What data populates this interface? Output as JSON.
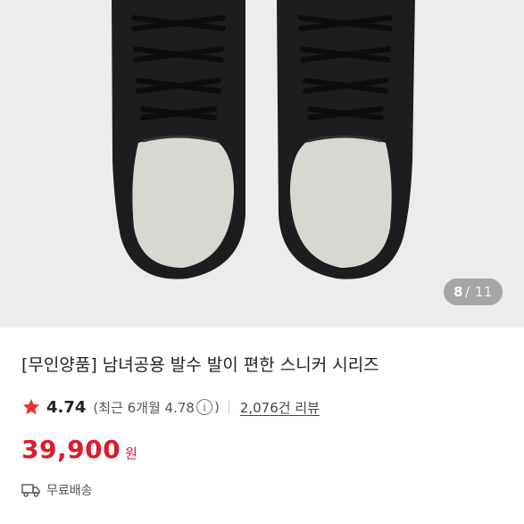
{
  "image_counter": {
    "current": "8",
    "total": "/ 11"
  },
  "product": {
    "title": "[무인양품] 남녀공용 발수 발이 편한 스니커 시리즈",
    "rating": "4.74",
    "recent_rating": "(최근 6개월 4.78",
    "recent_close": ")",
    "review_count": "2,076건 리뷰",
    "price": "39,900",
    "currency": "원",
    "shipping": "무료배송"
  },
  "colors": {
    "accent": "#e0192b",
    "star": "#e8332a",
    "background": "#ececec"
  },
  "icons": [
    "star-icon",
    "info-icon",
    "truck-icon"
  ]
}
